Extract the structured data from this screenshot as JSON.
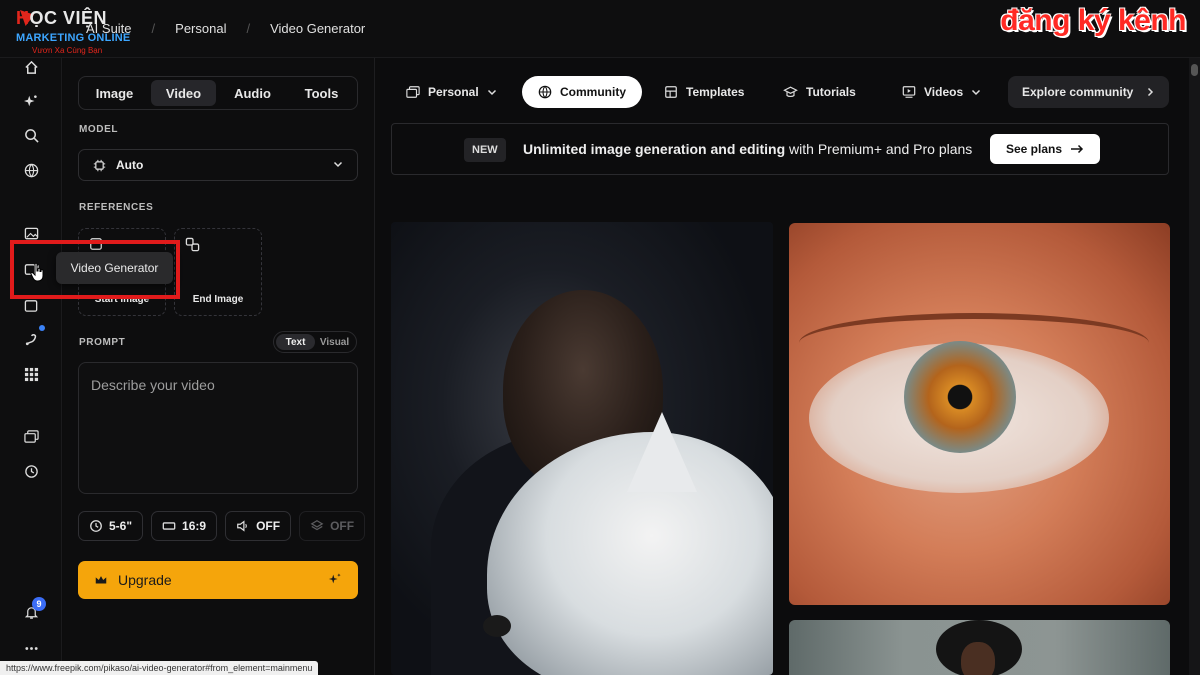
{
  "watermark": {
    "logo_line1_red": "H",
    "logo_line1": "ỌC VIỆN",
    "logo_line2": "MARKETING ONLINE",
    "logo_line3": "Vươn Xa Cùng Bạn",
    "channel_text": "đăng ký kênh"
  },
  "breadcrumb": {
    "items": [
      "AI Suite",
      "Personal",
      "Video Generator"
    ]
  },
  "rail": {
    "icons": [
      "home-icon",
      "sparkle-icon",
      "search-icon",
      "globe-icon",
      "image-icon",
      "video-icon",
      "edit-icon",
      "pen-icon",
      "apps-grid-icon",
      "gallery-icon",
      "history-icon",
      "bell-icon",
      "more-icon"
    ],
    "notifications_count": "9",
    "accent": "#3b82f6"
  },
  "tooltip": {
    "text": "Video Generator"
  },
  "panel": {
    "tabs": [
      {
        "label": "Image",
        "active": false
      },
      {
        "label": "Video",
        "active": true
      },
      {
        "label": "Audio",
        "active": false
      },
      {
        "label": "Tools",
        "active": false
      }
    ],
    "model_label": "MODEL",
    "model_value": "Auto",
    "references_label": "REFERENCES",
    "start_image": "Start Image",
    "end_image": "End Image",
    "prompt_label": "PROMPT",
    "prompt_mode_text": "Text",
    "prompt_mode_visual": "Visual",
    "prompt_placeholder": "Describe your video",
    "duration": "5-6\"",
    "aspect": "16:9",
    "audio": "OFF",
    "layers": "OFF",
    "upgrade": "Upgrade",
    "upgrade_color": "#f5a50b"
  },
  "nav": {
    "personal": "Personal",
    "community": "Community",
    "templates": "Templates",
    "tutorials": "Tutorials",
    "videos": "Videos",
    "explore": "Explore community"
  },
  "banner": {
    "badge": "NEW",
    "message_bold": "Unlimited image generation and editing",
    "message_rest": " with Premium+ and Pro plans",
    "button": "See plans"
  },
  "status_url": "https://www.freepik.com/pikaso/ai-video-generator#from_element=mainmenu",
  "highlight_color": "#e11b1b"
}
